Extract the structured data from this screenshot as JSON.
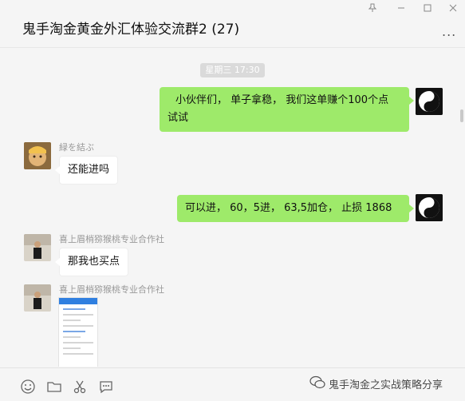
{
  "window": {
    "title": "鬼手淘金黄金外汇体验交流群2 (27)",
    "controls": [
      "pin-icon",
      "minimize-icon",
      "maximize-icon",
      "close-icon"
    ],
    "more_label": "..."
  },
  "chat": {
    "timestamp": "星期三 17:30",
    "messages": [
      {
        "side": "me",
        "lines": [
          "小伙伴们，  单子拿稳，  我们这单赚个100个点",
          "试试"
        ]
      },
      {
        "side": "other",
        "sender": "緑を結ぶ",
        "text": "还能进吗"
      },
      {
        "side": "me",
        "text": "可以进，  60，5进，  63,5加仓，  止损  1868"
      },
      {
        "side": "other",
        "sender": "喜上眉梢猕猴桃专业合作社",
        "text": "那我也买点"
      },
      {
        "side": "other",
        "sender": "喜上眉梢猕猴桃专业合作社",
        "type": "image"
      }
    ]
  },
  "toolbar": {
    "icons": [
      "emoji-icon",
      "folder-icon",
      "scissors-icon",
      "chat-bubble-icon"
    ]
  },
  "watermark": {
    "text": "鬼手淘金之实战策略分享"
  },
  "colors": {
    "bubble_me": "#9eea6a",
    "bubble_other": "#ffffff",
    "background": "#f5f5f5"
  }
}
